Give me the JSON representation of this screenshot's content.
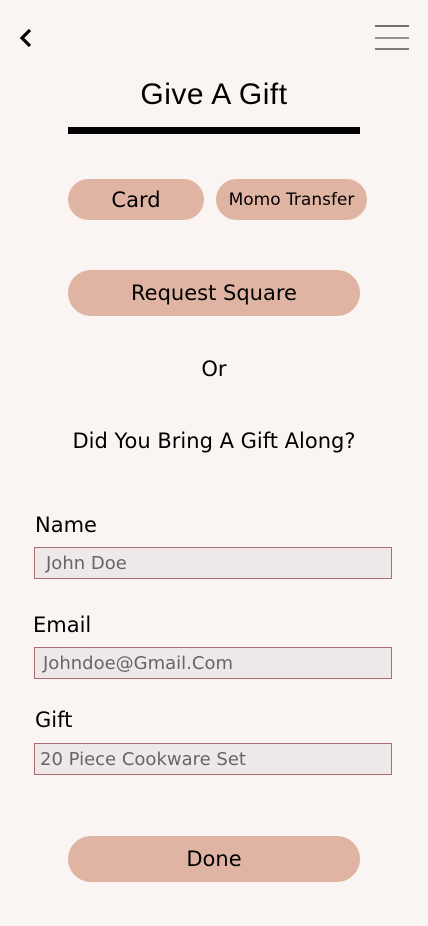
{
  "header": {
    "title": "Give A Gift"
  },
  "options": {
    "card": "Card",
    "momo": "Momo Transfer",
    "request_square": "Request Square"
  },
  "divider_text": "Or",
  "question": "Did You Bring A Gift Along?",
  "form": {
    "name": {
      "label": "Name",
      "placeholder": "John Doe"
    },
    "email": {
      "label": "Email",
      "placeholder": "Johndoe@Gmail.Com"
    },
    "gift": {
      "label": "Gift",
      "placeholder": "20 Piece Cookware Set"
    }
  },
  "done_label": "Done",
  "colors": {
    "background": "#faf5f2",
    "button": "#e0b4a3",
    "input_bg": "#efe8e8",
    "input_border": "#a86e72"
  }
}
